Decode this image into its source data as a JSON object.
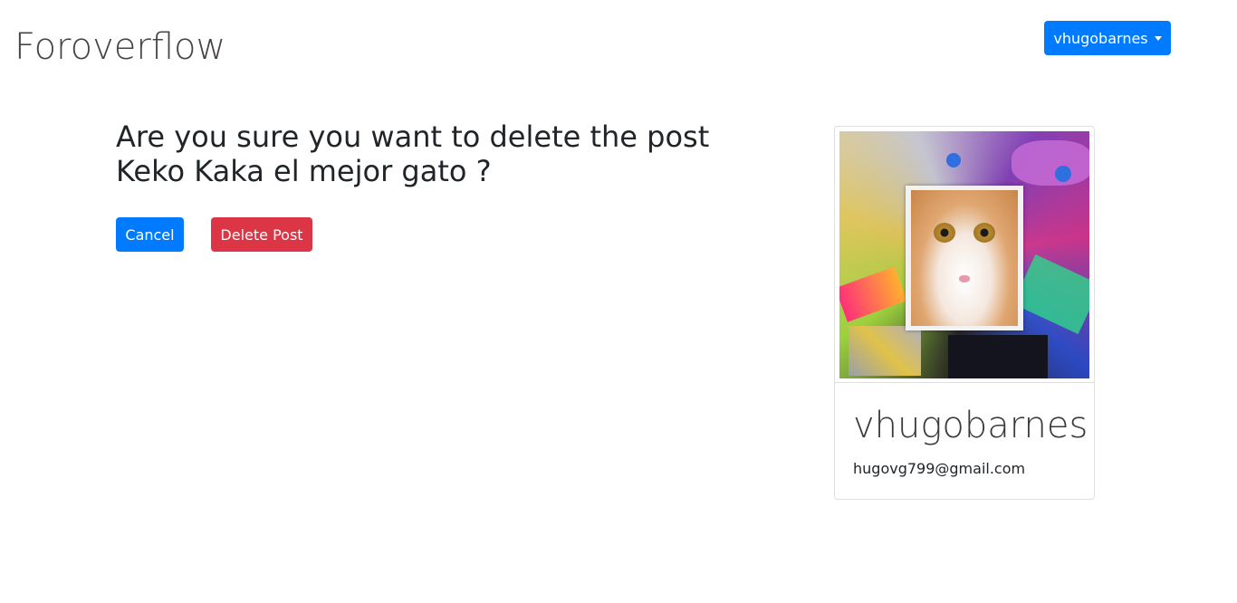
{
  "header": {
    "brand": "Foroverflow",
    "user_menu_label": "vhugobarnes"
  },
  "confirm": {
    "question": "Are you sure you want to delete the post Keko Kaka el mejor gato ?",
    "cancel_label": "Cancel",
    "delete_label": "Delete Post"
  },
  "profile": {
    "username": "vhugobarnes",
    "email": "hugovg799@gmail.com",
    "image_icon": "cat-photo-collage"
  },
  "colors": {
    "primary": "#007bff",
    "danger": "#dc3545"
  }
}
